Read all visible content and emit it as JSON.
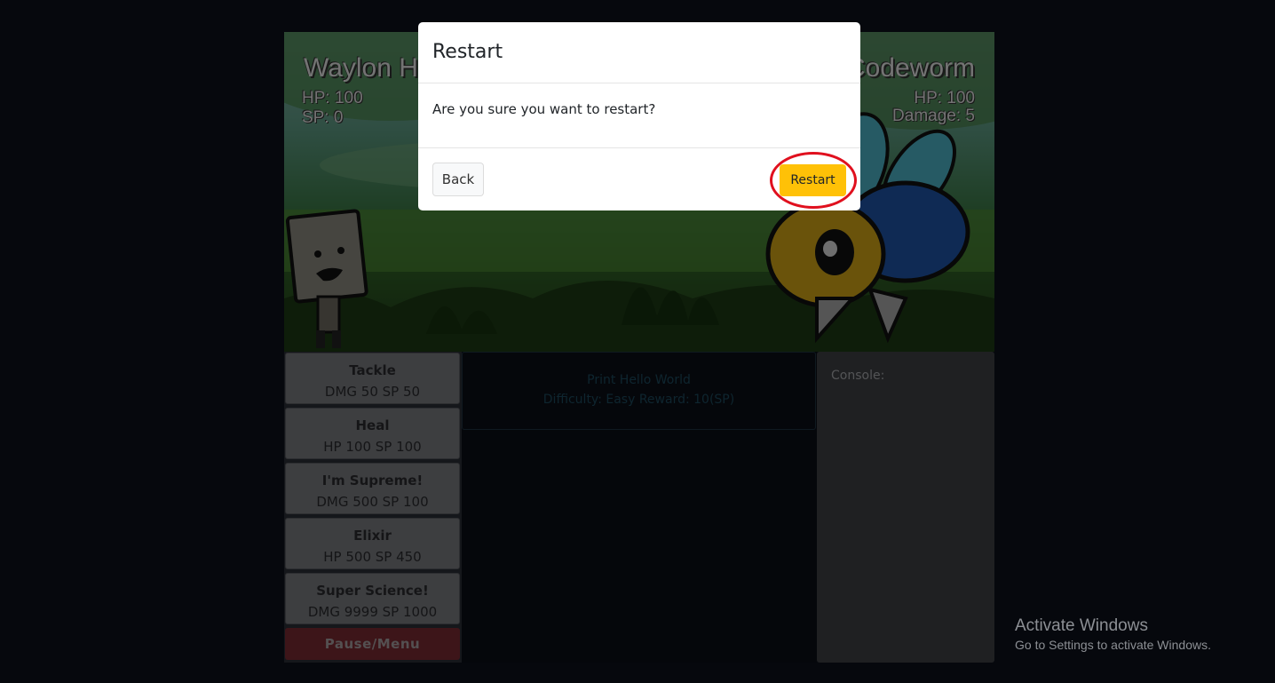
{
  "battle": {
    "player": {
      "name": "Waylon H",
      "hp": "HP: 100",
      "sp": "SP: 0"
    },
    "enemy": {
      "name": "Codeworm",
      "hp": "HP: 100",
      "damage": "Damage: 5"
    }
  },
  "skills": [
    {
      "name": "Tackle",
      "stats": "DMG 50 SP 50"
    },
    {
      "name": "Heal",
      "stats": "HP 100 SP 100"
    },
    {
      "name": "I'm Supreme!",
      "stats": "DMG 500 SP 100"
    },
    {
      "name": "Elixir",
      "stats": "HP 500 SP 450"
    },
    {
      "name": "Super Science!",
      "stats": "DMG 9999 SP 1000"
    }
  ],
  "pause_label": "Pause/Menu",
  "task": {
    "title": "Print Hello World",
    "info": "Difficulty: Easy Reward: 10(SP)"
  },
  "console": {
    "label": "Console:"
  },
  "modal": {
    "title": "Restart",
    "body": "Are you sure you want to restart?",
    "back_label": "Back",
    "restart_label": "Restart"
  },
  "watermark": {
    "title": "Activate Windows",
    "subtitle": "Go to Settings to activate Windows."
  },
  "colors": {
    "restart_button": "#ffc107",
    "highlight_ring": "#e0101e",
    "pause_button": "#7a2a32"
  }
}
